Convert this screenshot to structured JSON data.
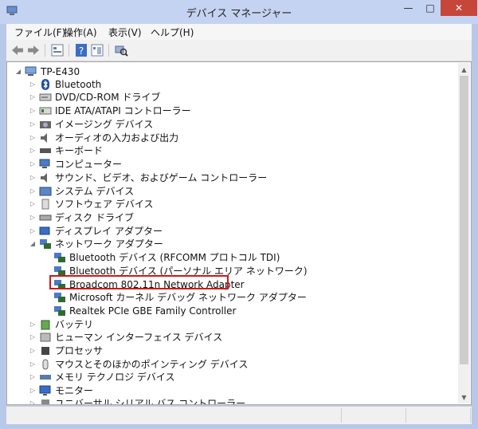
{
  "title": "デバイス マネージャー",
  "window_buttons": {
    "minimize": "—",
    "maximize": "□",
    "close": "✕"
  },
  "menu": [
    "ファイル(F)",
    "操作(A)",
    "表示(V)",
    "ヘルプ(H)"
  ],
  "toolbar_icons": [
    "back-arrow-icon",
    "forward-arrow-icon",
    "properties-icon",
    "help-icon",
    "view-icon",
    "scan-hardware-icon"
  ],
  "root": "TP-E430",
  "categories": [
    "Bluetooth",
    "DVD/CD-ROM ドライブ",
    "IDE ATA/ATAPI コントローラー",
    "イメージング デバイス",
    "オーディオの入力および出力",
    "キーボード",
    "コンピューター",
    "サウンド、ビデオ、およびゲーム コントローラー",
    "システム デバイス",
    "ソフトウェア デバイス",
    "ディスク ドライブ",
    "ディスプレイ アダプター",
    "ネットワーク アダプター"
  ],
  "network_children": [
    "Bluetooth デバイス (RFCOMM プロトコル TDI)",
    "Bluetooth デバイス (パーソナル エリア ネットワーク)",
    "Broadcom 802.11n Network Adapter",
    "Microsoft カーネル デバッグ ネットワーク アダプター",
    "Realtek PCIe GBE Family Controller"
  ],
  "after_categories": [
    "バッテリ",
    "ヒューマン インターフェイス デバイス",
    "プロセッサ",
    "マウスとそのほかのポインティング デバイス",
    "メモリ テクノロジ デバイス",
    "モニター",
    "ユニバーサル シリアル バス コントローラー"
  ],
  "highlighted_item": "Broadcom 802.11n Network Adapter",
  "colors": {
    "title_bar": "#c5d3f2",
    "close_button": "#c7463a",
    "highlight_border": "#d01818"
  }
}
